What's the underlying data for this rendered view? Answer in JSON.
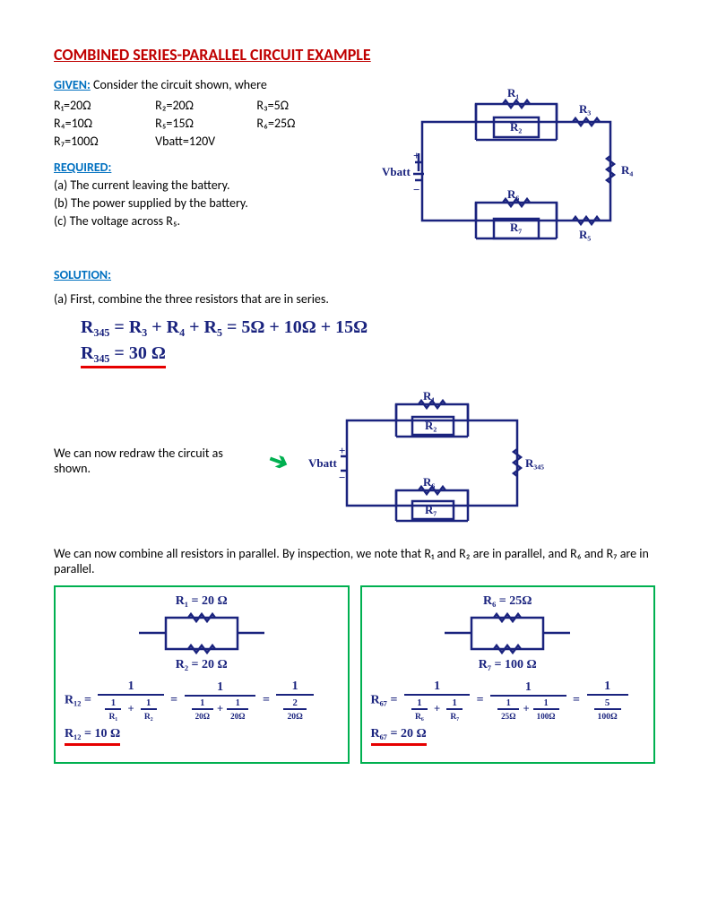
{
  "title": "COMBINED SERIES-PARALLEL CIRCUIT EXAMPLE",
  "given_label": "GIVEN:",
  "given_text": " Consider the circuit shown, where",
  "resistors": {
    "r1": "R₁=20Ω",
    "r2": "R₂=20Ω",
    "r3": "R₃=5Ω",
    "r4": "R₄=10Ω",
    "r5": "R₅=15Ω",
    "r6": "R₆=25Ω",
    "r7": "R₇=100Ω",
    "vbatt": "Vbatt=120V"
  },
  "required_label": "REQUIRED:",
  "required": {
    "a": "(a) The current leaving the battery.",
    "b": "(b) The power supplied by the battery.",
    "c": "(c) The voltage across R₅."
  },
  "solution_label": "SOLUTION:",
  "step_a_intro": "(a) First, combine the three resistors that are in series.",
  "eq1_line1": "R₃₄₅  =  R₃ + R₄ + R₅  =  5Ω + 10Ω + 15Ω",
  "eq1_line2": "R₃₄₅ =  30 Ω",
  "redraw_text": "We can now redraw the circuit as shown.",
  "parallel_text": "We can now combine all resistors in parallel. By inspection, we note that R₁ and R₂ are in parallel, and R₆ and R₇ are in parallel.",
  "box1": {
    "top": "R₁ = 20 Ω",
    "bot": "R₂ = 20 Ω",
    "eq_lhs": "R₁₂ =",
    "d1a": "R₁",
    "d1b": "R₂",
    "d2a": "20Ω",
    "d2b": "20Ω",
    "d3": "20Ω",
    "d3n": "2",
    "result": "R₁₂ =  10 Ω"
  },
  "box2": {
    "top": "R₆ = 25Ω",
    "bot": "R₇ = 100 Ω",
    "eq_lhs": "R₆₇ =",
    "d1a": "R₆",
    "d1b": "R₇",
    "d2a": "25Ω",
    "d2b": "100Ω",
    "d3": "100Ω",
    "d3n": "5",
    "result": "R₆₇ =  20 Ω"
  },
  "circ1": {
    "vbatt": "Vbatt",
    "r1": "R₁",
    "r2": "R₂",
    "r3": "R₃",
    "r4": "R₄",
    "r5": "R₅",
    "r6": "R₆",
    "r7": "R₇"
  },
  "circ2": {
    "vbatt": "Vbatt",
    "r1": "R₁",
    "r2": "R₂",
    "r6": "R₆",
    "r7": "R₇",
    "r345": "R₃₄₅"
  }
}
